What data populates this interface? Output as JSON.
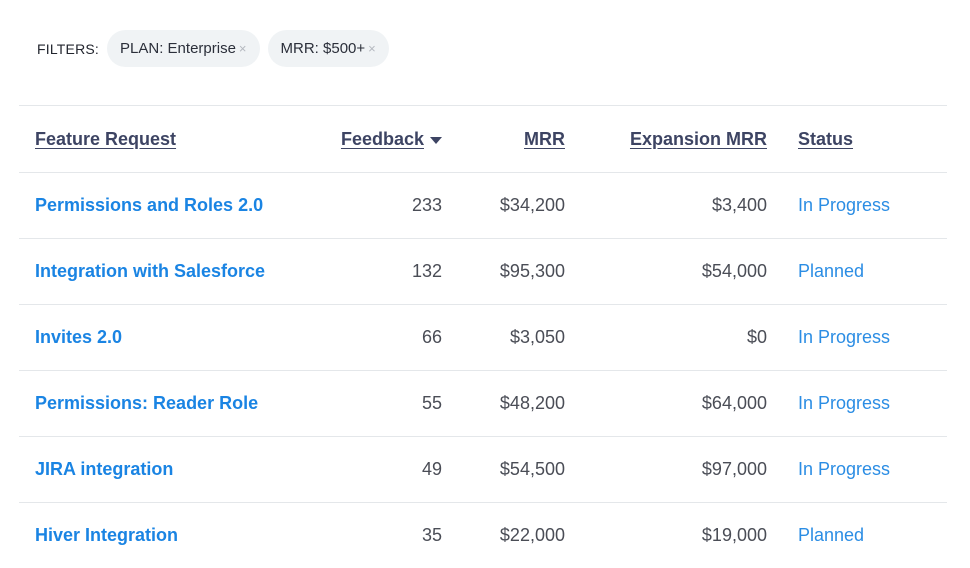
{
  "filters": {
    "label": "FILTERS:",
    "chips": [
      {
        "text": "PLAN: Enterprise",
        "remove": "×"
      },
      {
        "text": "MRR: $500+",
        "remove": "×"
      }
    ]
  },
  "table": {
    "headers": {
      "feature": "Feature Request",
      "feedback": "Feedback",
      "mrr": "MRR",
      "expansion": "Expansion MRR",
      "status": "Status"
    },
    "sort": {
      "column": "feedback",
      "direction": "desc",
      "icon": "caret-down-icon"
    },
    "rows": [
      {
        "feature": "Permissions and Roles 2.0",
        "feedback": "233",
        "mrr": "$34,200",
        "expansion": "$3,400",
        "status": "In Progress"
      },
      {
        "feature": "Integration with Salesforce",
        "feedback": "132",
        "mrr": "$95,300",
        "expansion": "$54,000",
        "status": "Planned"
      },
      {
        "feature": "Invites 2.0",
        "feedback": "66",
        "mrr": "$3,050",
        "expansion": "$0",
        "status": "In Progress"
      },
      {
        "feature": "Permissions: Reader Role",
        "feedback": "55",
        "mrr": "$48,200",
        "expansion": "$64,000",
        "status": "In Progress"
      },
      {
        "feature": "JIRA integration",
        "feedback": "49",
        "mrr": "$54,500",
        "expansion": "$97,000",
        "status": "In Progress"
      },
      {
        "feature": "Hiver Integration",
        "feedback": "35",
        "mrr": "$22,000",
        "expansion": "$19,000",
        "status": "Planned"
      }
    ]
  },
  "colors": {
    "link": "#1a84e3",
    "status": "#2b8de4",
    "header": "#3d4463",
    "chip_bg": "#f0f3f5",
    "divider": "#e4e7ea"
  }
}
